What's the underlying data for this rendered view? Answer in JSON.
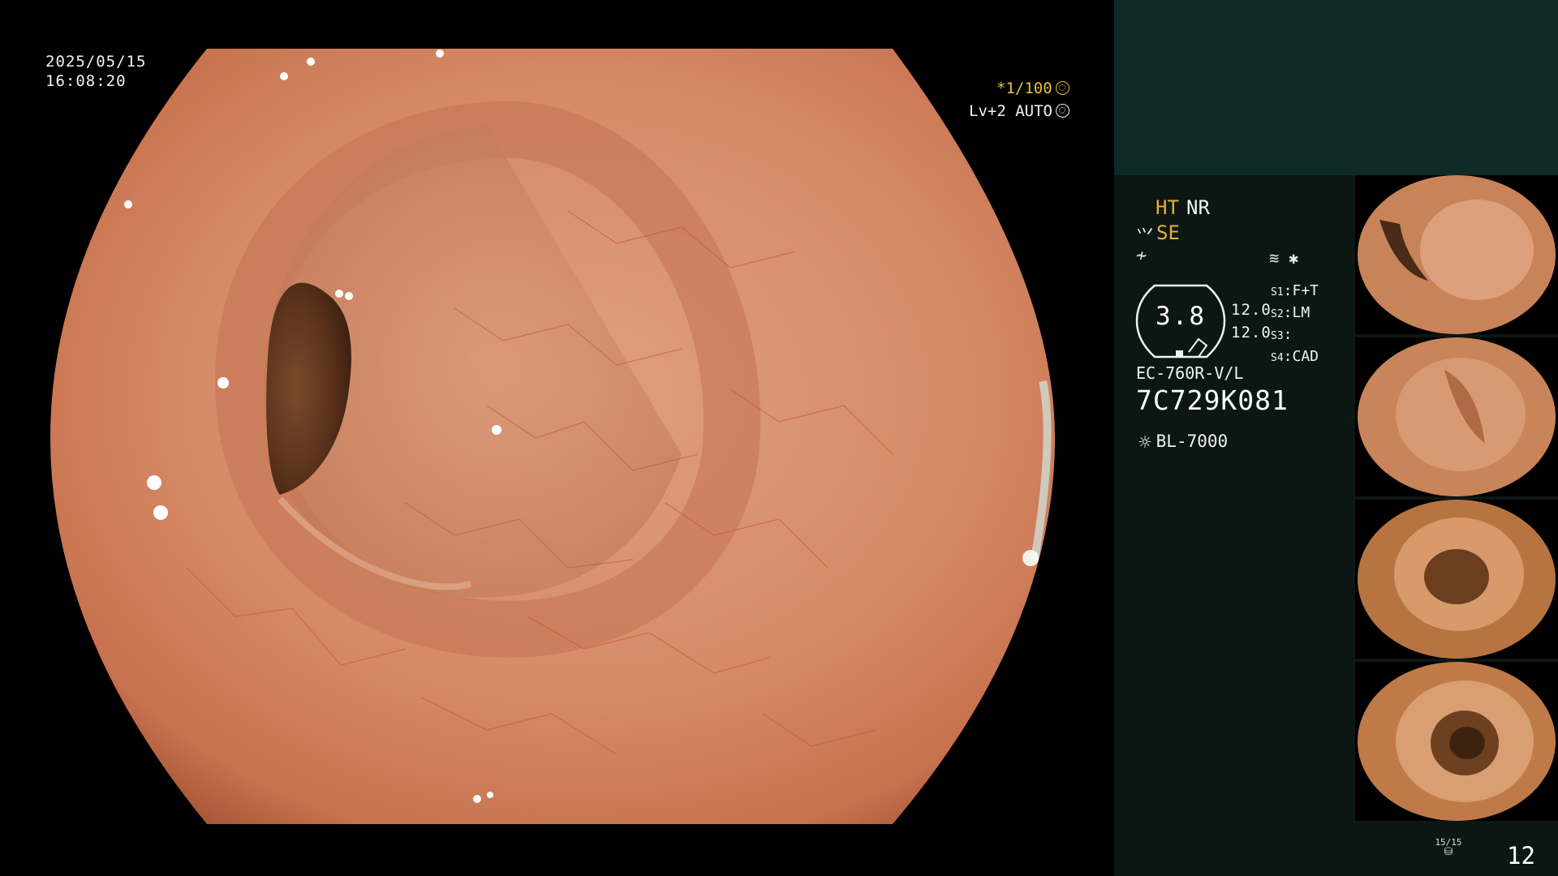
{
  "overlay": {
    "date": "2025/05/15",
    "time": "16:08:20",
    "shutter": "*1/100",
    "iris": "Lv+2 AUTO"
  },
  "panel": {
    "modes": {
      "ht": "HT",
      "nr": "NR",
      "se": "SE",
      "se_icon": "⺍",
      "f_icon": "≁"
    },
    "aux_icons": [
      "image-mode-icon",
      "asterisk-icon"
    ],
    "gauge": {
      "value": "3.8",
      "reading_1": "12.0",
      "reading_2": "12.0"
    },
    "scope_settings": [
      {
        "key": "S1",
        "value": "F+T"
      },
      {
        "key": "S2",
        "value": "LM"
      },
      {
        "key": "S3",
        "value": ""
      },
      {
        "key": "S4",
        "value": "CAD"
      }
    ],
    "scope_model": "EC-760R-V/L",
    "scope_serial": "7C729K081",
    "light_source": "BL-7000",
    "record_counter": "15/15",
    "image_count": "12"
  },
  "colors": {
    "panel_bg": "#0c1714",
    "panel_top_bg": "#0f2a26",
    "accent_orange": "#e8b030",
    "shutter_yellow": "#e8c23a",
    "mucosa": "#d98a68"
  }
}
